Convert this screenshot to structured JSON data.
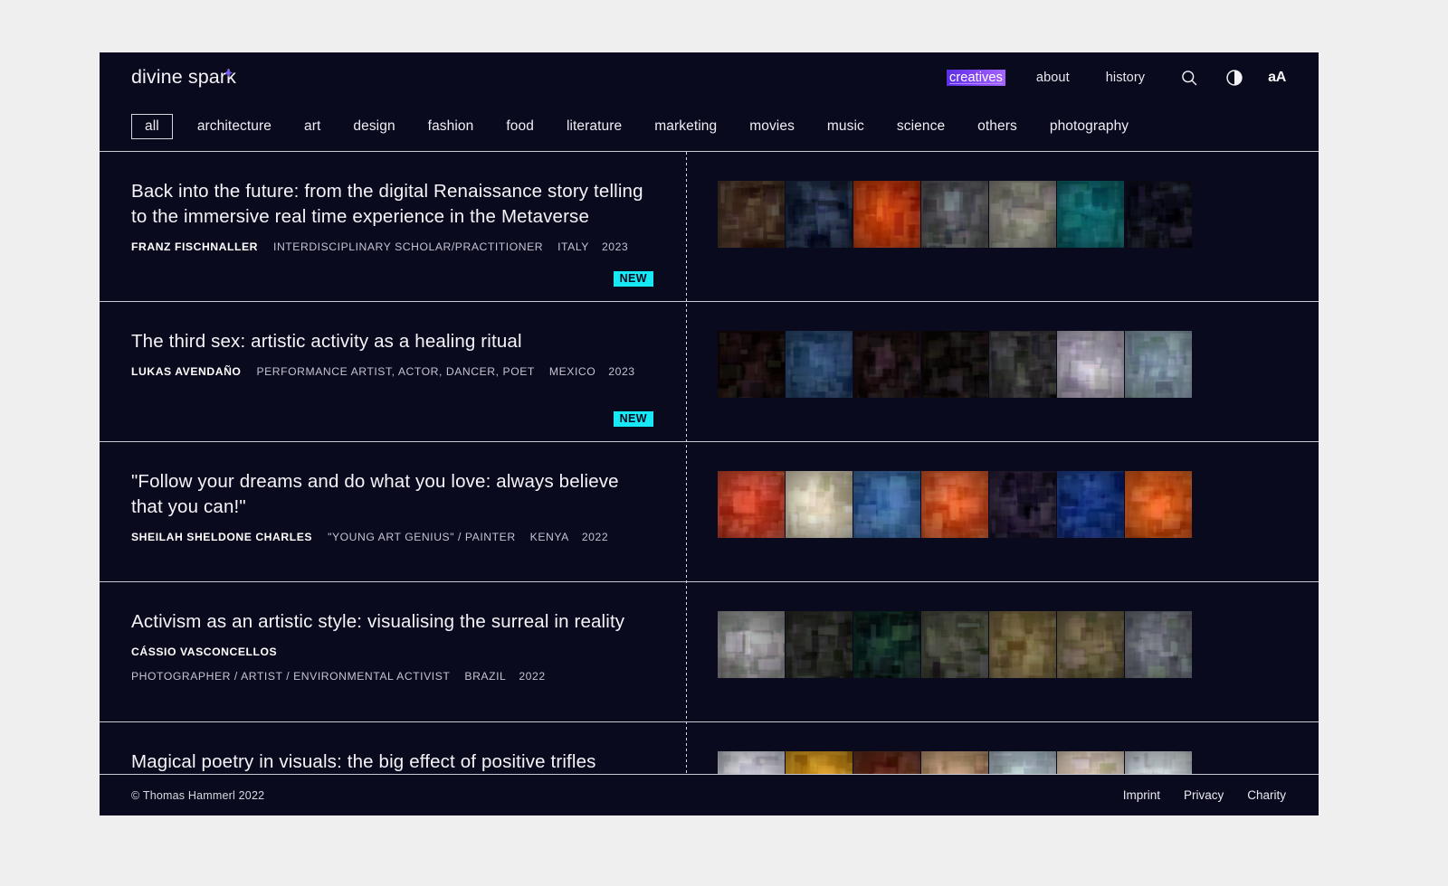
{
  "brand": {
    "name_part1": "divine spar",
    "name_last": "k",
    "accent_color": "#7b5cf0"
  },
  "header": {
    "nav": [
      {
        "label": "creatives",
        "active": true
      },
      {
        "label": "about",
        "active": false
      },
      {
        "label": "history",
        "active": false
      }
    ],
    "icons": [
      {
        "name": "search-icon",
        "label": "search"
      },
      {
        "name": "contrast-icon",
        "label": "contrast"
      }
    ],
    "font_size_toggle": "aA"
  },
  "categories": [
    {
      "label": "all",
      "selected": true
    },
    {
      "label": "architecture",
      "selected": false
    },
    {
      "label": "art",
      "selected": false
    },
    {
      "label": "design",
      "selected": false
    },
    {
      "label": "fashion",
      "selected": false
    },
    {
      "label": "food",
      "selected": false
    },
    {
      "label": "literature",
      "selected": false
    },
    {
      "label": "marketing",
      "selected": false
    },
    {
      "label": "movies",
      "selected": false
    },
    {
      "label": "music",
      "selected": false
    },
    {
      "label": "science",
      "selected": false
    },
    {
      "label": "others",
      "selected": false
    },
    {
      "label": "photography",
      "selected": false
    }
  ],
  "badge_label": "NEW",
  "accent_cyan": "#16e8f5",
  "entries": [
    {
      "title": "Back into the future: from the digital Renaissance story telling to the immersive real time experience in the Metaverse",
      "name": "FRANZ FISCHNALLER",
      "role": "INTERDISCIPLINARY SCHOLAR/PRACTITIONER",
      "country": "ITALY",
      "year": "2023",
      "is_new": true,
      "stacked_meta": false,
      "thumbs": [
        "#4a3527",
        "#1d2b44",
        "#c43b08",
        "#5a5a5f",
        "#8d8a80",
        "#0d6b72",
        "#121224"
      ]
    },
    {
      "title": "The third sex: artistic activity as a healing ritual",
      "name": "LUKAS AVENDAÑO",
      "role": "PERFORMANCE ARTIST, ACTOR, DANCER, POET",
      "country": "MEXICO",
      "year": "2023",
      "is_new": true,
      "stacked_meta": false,
      "thumbs": [
        "#140604",
        "#2e4c73",
        "#1a0d0e",
        "#120b0a",
        "#3b3a3c",
        "#b9b2c2",
        "#8aa0ad"
      ]
    },
    {
      "title": "\"Follow your dreams and do what you love: always believe that you can!\"",
      "name": "SHEILAH SHELDONE CHARLES",
      "role": "\"YOUNG ART GENIUS\" / PAINTER",
      "country": "KENYA",
      "year": "2022",
      "is_new": false,
      "stacked_meta": false,
      "thumbs": [
        "#d2452c",
        "#e8dcc2",
        "#3f6ea8",
        "#e05b2a",
        "#2a1f38",
        "#1c3f8d",
        "#e8611f"
      ]
    },
    {
      "title": "Activism as an artistic style: visualising the surreal in reality",
      "name": "CÁSSIO VASCONCELLOS",
      "role": "PHOTOGRAPHER / ARTIST / ENVIRONMENTAL ACTIVIST",
      "country": "BRAZIL",
      "year": "2022",
      "is_new": false,
      "stacked_meta": true,
      "thumbs": [
        "#9b9b9b",
        "#2a2a26",
        "#0d2a24",
        "#4d5043",
        "#7b6a42",
        "#6f6346",
        "#6b6f78"
      ]
    },
    {
      "title": "Magical poetry in visuals: the big effect of positive trifles",
      "name": "",
      "role": "",
      "country": "",
      "year": "",
      "is_new": false,
      "stacked_meta": false,
      "thumbs": [
        "#dcdce8",
        "#d99a1e",
        "#6a3321",
        "#c8a27a",
        "#b7c7d1",
        "#e8d5c0",
        "#cfd8dd"
      ]
    }
  ],
  "footer": {
    "copyright": "© Thomas Hammerl 2022",
    "links": [
      {
        "label": "Imprint"
      },
      {
        "label": "Privacy"
      },
      {
        "label": "Charity"
      }
    ]
  }
}
